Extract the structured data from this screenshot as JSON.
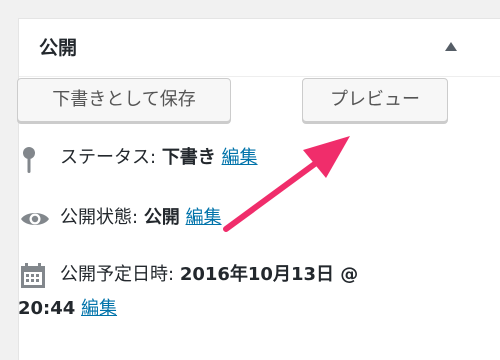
{
  "panel": {
    "title": "公開",
    "toggle_icon": "triangle-up-icon"
  },
  "actions": {
    "save_draft_label": "下書きとして保存",
    "preview_label": "プレビュー"
  },
  "status": {
    "icon": "map-pin-icon",
    "label": "ステータス:",
    "value": "下書き",
    "edit_label": "編集"
  },
  "visibility": {
    "icon": "eye-icon",
    "label": "公開状態:",
    "value": "公開",
    "edit_label": "編集"
  },
  "schedule": {
    "icon": "calendar-icon",
    "label": "公開予定日時:",
    "date": "2016年10月13日 @",
    "time": "20:44",
    "edit_label": "編集"
  },
  "annotation": {
    "arrow_color": "#f02d6b"
  },
  "colors": {
    "link": "#0073aa",
    "button_bg": "#f7f7f7",
    "panel_bg": "#ffffff",
    "page_bg": "#f1f1f1"
  }
}
